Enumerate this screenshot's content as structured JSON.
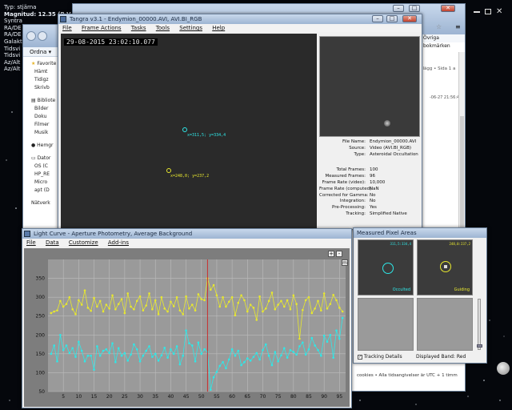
{
  "stellarium": {
    "info_lines": [
      "Typ: stjärna",
      "Magnitud: 12.35 (B-V",
      "Syntra",
      "RA/DE",
      "RA/DE",
      "Galakt",
      "Tidsvi",
      "Tidsvi",
      "Az/Alt",
      "Az/Alt"
    ]
  },
  "explorer": {
    "organize_label": "Ordna ▾",
    "items": [
      "Favorite",
      "Hämt",
      "Tidigz",
      "Skrivb",
      "Bibliote",
      "Bilder",
      "Doku",
      "Filmer",
      "Musik",
      "Hemgr",
      "Dator",
      "OS (C",
      "HP_RE",
      "Micro",
      "apt (D",
      "Nätverk"
    ]
  },
  "browser": {
    "bookmarks": "Övriga bokmärken",
    "snippet1": "nlägg • Sida 1 a",
    "snippet2": "-06-27 21:56:45",
    "footer": "cookies • Alla tidsangivelser är UTC + 1 timm"
  },
  "tangra": {
    "title": "Tangra v3.1 - Endymion_00000.AVI, AVI.BI_RGB",
    "menu": [
      "File",
      "Frame Actions",
      "Tasks",
      "Tools",
      "Settings",
      "Help"
    ],
    "timestamp": "29-08-2015 23:02:10.077",
    "target1_label": "x=311,5; y=334,4",
    "target2_label": "x=248,0; y=237,2",
    "properties": [
      {
        "k": "File Name:",
        "v": "Endymion_00000.AVI"
      },
      {
        "k": "Source:",
        "v": "Video (AVI.BI_RGB)"
      },
      {
        "k": "Type:",
        "v": "Asteroidal Occultation"
      },
      {
        "k": "",
        "v": ""
      },
      {
        "k": "Total Frames:",
        "v": "100"
      },
      {
        "k": "Measured Frames:",
        "v": "96"
      },
      {
        "k": "Frame Rate (video):",
        "v": "10,000"
      },
      {
        "k": "Frame Rate (computed):",
        "v": "NaN"
      },
      {
        "k": "Corrected for Gamma:",
        "v": "No"
      },
      {
        "k": "Integration:",
        "v": "No"
      },
      {
        "k": "Pre-Processing:",
        "v": "Yes"
      },
      {
        "k": "Tracking:",
        "v": "Simplified Native"
      }
    ]
  },
  "light_curve": {
    "title": "Light Curve - Aperture Photometry, Average Background",
    "menu": [
      "File",
      "Data",
      "Customize",
      "Add-ins"
    ],
    "zoom_plus": "+",
    "zoom_minus": "-",
    "m_button": "m"
  },
  "pixel_areas": {
    "title": "Measured Pixel Areas",
    "cell1_top": "311,5:334,4",
    "cell2_top": "248,0:237,2",
    "cell1_label": "Occulted",
    "cell2_label": "Guiding",
    "tracking_details": "Tracking Details",
    "displayed_band": "Displayed Band: Red"
  },
  "colors": {
    "occulted": "#2ee8e8",
    "guiding": "#e8e82e",
    "cursor": "#c83030"
  },
  "chart_data": {
    "type": "line",
    "x": [
      1,
      2,
      3,
      4,
      5,
      6,
      7,
      8,
      9,
      10,
      11,
      12,
      13,
      14,
      15,
      16,
      17,
      18,
      19,
      20,
      21,
      22,
      23,
      24,
      25,
      26,
      27,
      28,
      29,
      30,
      31,
      32,
      33,
      34,
      35,
      36,
      37,
      38,
      39,
      40,
      41,
      42,
      43,
      44,
      45,
      46,
      47,
      48,
      49,
      50,
      51,
      52,
      53,
      54,
      55,
      56,
      57,
      58,
      59,
      60,
      61,
      62,
      63,
      64,
      65,
      66,
      67,
      68,
      69,
      70,
      71,
      72,
      73,
      74,
      75,
      76,
      77,
      78,
      79,
      80,
      81,
      82,
      83,
      84,
      85,
      86,
      87,
      88,
      89,
      90,
      91,
      92,
      93,
      94,
      95,
      96
    ],
    "series": [
      {
        "color": "#e8e82e",
        "values": [
          258,
          262,
          265,
          290,
          275,
          282,
          300,
          268,
          255,
          292,
          280,
          318,
          272,
          264,
          298,
          275,
          290,
          262,
          280,
          270,
          305,
          268,
          282,
          295,
          258,
          310,
          275,
          268,
          290,
          302,
          265,
          278,
          310,
          268,
          292,
          255,
          300,
          270,
          262,
          288,
          276,
          300,
          265,
          255,
          302,
          270,
          280,
          265,
          308,
          295,
          292,
          350,
          320,
          332,
          305,
          275,
          300,
          275,
          288,
          300,
          252,
          285,
          305,
          292,
          262,
          280,
          272,
          240,
          302,
          262,
          270,
          290,
          312,
          268,
          280,
          290,
          275,
          292,
          268,
          305,
          282,
          190,
          266,
          292,
          300,
          258,
          270,
          290,
          265,
          310,
          270,
          282,
          306,
          292,
          272,
          262
        ]
      },
      {
        "color": "#2ee8e8",
        "values": [
          150,
          172,
          130,
          200,
          160,
          172,
          152,
          165,
          142,
          182,
          158,
          130,
          145,
          145,
          108,
          170,
          145,
          158,
          162,
          152,
          178,
          128,
          165,
          145,
          152,
          132,
          148,
          175,
          162,
          130,
          145,
          158,
          170,
          142,
          150,
          132,
          146,
          166,
          140,
          162,
          150,
          170,
          122,
          145,
          212,
          178,
          172,
          130,
          180,
          150,
          162,
          155,
          55,
          88,
          102,
          118,
          128,
          112,
          135,
          162,
          145,
          158,
          120,
          128,
          138,
          132,
          142,
          152,
          135,
          160,
          175,
          145,
          120,
          155,
          130,
          146,
          165,
          140,
          160,
          155,
          148,
          170,
          180,
          148,
          162,
          192,
          172,
          160,
          145,
          198,
          182,
          200,
          140,
          212,
          190,
          245
        ]
      }
    ],
    "xlim": [
      0,
      97
    ],
    "ylim": [
      50,
      400
    ],
    "x_ticks": [
      5,
      10,
      15,
      20,
      25,
      30,
      35,
      40,
      45,
      50,
      55,
      60,
      65,
      70,
      75,
      80,
      85,
      90,
      95
    ],
    "y_ticks": [
      50,
      100,
      150,
      200,
      250,
      300,
      350
    ],
    "cursor_x": 52,
    "grid": true
  }
}
